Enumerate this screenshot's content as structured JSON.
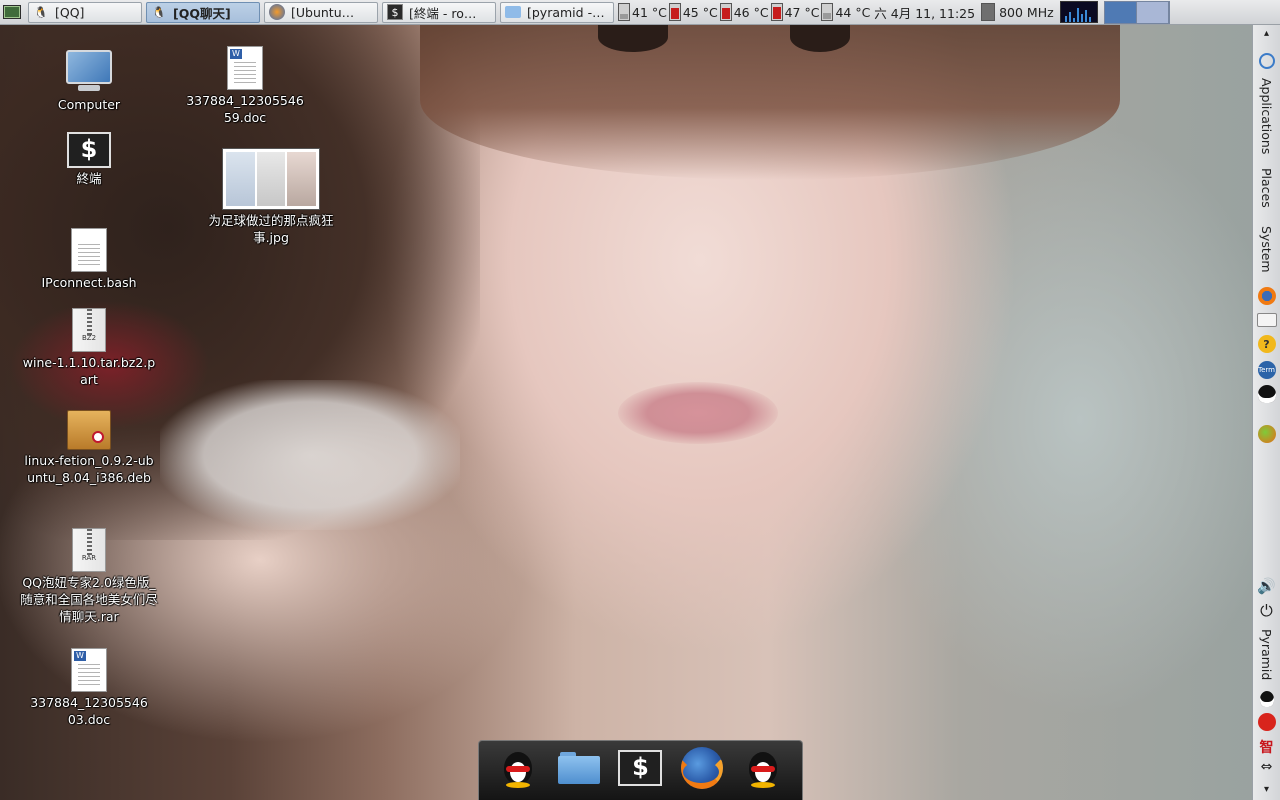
{
  "taskbar": {
    "tasks": [
      {
        "label": "[QQ]",
        "icon": "qq-penguin-icon",
        "active": false
      },
      {
        "label": "[QQ聊天]",
        "icon": "qq-penguin-icon",
        "active": true
      },
      {
        "label": "[Ubuntu…",
        "icon": "firefox-icon",
        "active": false
      },
      {
        "label": "[終端 - ro…",
        "icon": "terminal-icon",
        "active": false
      },
      {
        "label": "[pyramid -…",
        "icon": "folder-icon",
        "active": false
      }
    ],
    "temperatures": [
      {
        "label": "41 °C",
        "level": 0.3
      },
      {
        "label": "45 °C",
        "level": 0.7
      },
      {
        "label": "46 °C",
        "level": 0.7
      },
      {
        "label": "47 °C",
        "level": 0.75
      },
      {
        "label": "44 °C",
        "level": 0.35
      }
    ],
    "clock": "六  4月 11, 11:25",
    "cpu_freq": "800 MHz",
    "workspaces": 2,
    "active_workspace": 1
  },
  "right_panel": {
    "menus": [
      "Applications",
      "Places",
      "System"
    ],
    "user": "Pyramid",
    "launchers": [
      "firefox-icon",
      "mail-icon",
      "help-icon",
      "terminal-icon",
      "qq-penguin-icon",
      "ball-icon"
    ],
    "tray": [
      "volume-icon",
      "power-icon"
    ],
    "tray_bottom": [
      "qq-penguin-icon",
      "fetion-icon",
      "ime-icon",
      "network-icon"
    ],
    "ime_char": "智"
  },
  "desktop_icons": [
    {
      "label": "Computer",
      "type": "computer"
    },
    {
      "label": "終端",
      "type": "terminal"
    },
    {
      "label": "IPconnect.bash",
      "type": "text"
    },
    {
      "label": "wine-1.1.10.tar.bz2.part",
      "type": "bz2"
    },
    {
      "label": "linux-fetion_0.9.2-ubuntu_8.04_i386.deb",
      "type": "deb"
    },
    {
      "label": "QQ泡妞专家2.0绿色版_随意和全国各地美女们尽情聊天.rar",
      "type": "rar"
    },
    {
      "label": "337884_1230554603.doc",
      "type": "doc"
    },
    {
      "label": "337884_1230554659.doc",
      "type": "doc"
    },
    {
      "label": "为足球做过的那点疯狂事.jpg",
      "type": "image"
    }
  ],
  "dock": {
    "items": [
      "qq-penguin-icon",
      "folder-icon",
      "terminal-icon",
      "firefox-icon",
      "qq-penguin-icon"
    ]
  },
  "colors": {
    "panel": "#d9dcdf",
    "active_task": "#b3c8e2",
    "workspace_active": "#4f7ab4",
    "thermometer_fill": "#c61d1d"
  }
}
